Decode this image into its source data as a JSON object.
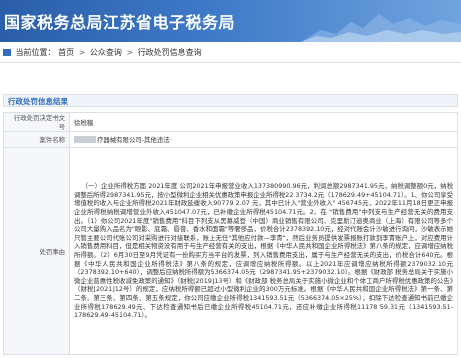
{
  "header": {
    "site_title": "国家税务总局江苏省电子税务局"
  },
  "breadcrumb": {
    "prefix": "当前位置：",
    "items": [
      "首页",
      "公众查询",
      "行政处罚信息查询"
    ],
    "separator": ">"
  },
  "result": {
    "header": "行政处罚信息结果",
    "rows": [
      {
        "label": "行政处罚决定书文号",
        "value": "徐税稽"
      },
      {
        "label": "案件名称",
        "value": "疗器械有限公司-其他违法"
      },
      {
        "label": "处罚事由",
        "value": "（一）企业所得税方面 2021年度 公司2021年申报营业收入137380990.96元，利润总额2987341.95元，纳税调整额0元，纳税调整后所得2987341.95元，按小型微利企业相关优惠政策申报企业所得税22 3734.2元（178629.49+45104.71）。1、你公司享受增值税的收入与企业所得税2021年财政延缓收入90779 2.07 元，其中已计入\"营业外收入\" 456745元，2022年11月18日更正申报企业所得税纳税调增营业外收入451047.07元，已补缴企业所得税45104.71元。2、在 \"销售费用\"中列支与生产经营无关的费用支出。（1）你公司2021年度\"销售费用\"科目下列支从黑慕威登（中国）商业销售有限公司、克里斯汀迪奥商业（上海）有限公司等多个公司大量购入品名为\"眼影、底霜、唇膏、香水和面霜\"等奢侈品，价税合计2378392.10元，经对代账会计沙敏进行询问，沙敏表示她只管主要公司代账公司对采购进行对接联系，账上无任\"其他应付款—李青\"，然后业务员提供发票报账打款到李青账户上，对应费用计入销售费用科目，但是相关物资没有用于与生产经营有关的支出，根据《中华人民共和国企业所得税法》第八条的规定，应调增应纳税所得额。（2）6月30日至9月凭证有一份购买方当平台的发票，列入销售费用支出，属于与生产经营无关的支出，价税合计640元。根据《中华人民共和国企业所得税法》第八条的规定，应调增应纳税所得额。以上2021年应调增应纳税所得额2379032.10元（2378392.10+640），调整后应纳税所得额为5366374.05元（2987341.95+2379032.10）。根据《财政部 税务总局关于实施小微企业普惠性税收减免政策的通知》（财税[2019]13号）和《财政部 税务总局关于实施小微企业和个体工商户所得税优惠政策的公告》（财税[2021]12号）的规定，应纳税所得额已超过小型微利企业的300万元标准。根据《中华人民共和国企业所得税法》第一条、第二条、第三条、第四条、第五条规定，你公司应缴企业所得税1341593.51元（5366374.05×25%），扣除下达检查通知书前已缴企业所得税178629.49元、下达检查通知书后已缴企业所得税45104.71元，还应补缴企业所得税11178 59.31元（1341593.51-178629.49-45104.71）。"
      }
    ]
  },
  "colors": {
    "banner_blue": "#2a5ea8",
    "accent_blue": "#2f6fbd",
    "border": "#d9e0e8"
  }
}
